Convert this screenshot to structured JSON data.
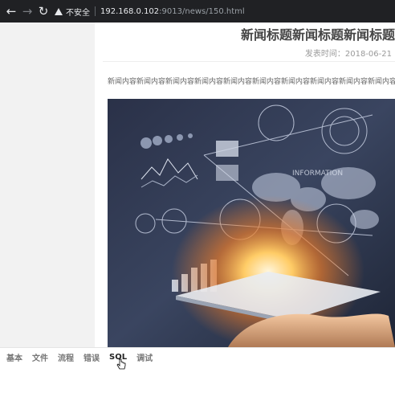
{
  "browser": {
    "security_label": "不安全",
    "url_host": "192.168.0.102",
    "url_path": ":9013/news/150.html"
  },
  "article": {
    "title": "新闻标题新闻标题新闻标题",
    "date": "发表时间：2018-06-21",
    "content": "新闻内容新闻内容新闻内容新闻内容新闻内容新闻内容新闻内容新闻内容新闻内容新闻内容"
  },
  "hero_image": {
    "overlay_text": "INFORMATION"
  },
  "devtools": {
    "tabs": [
      "基本",
      "文件",
      "流程",
      "错误",
      "SQL",
      "调试"
    ],
    "active_tab": "SQL"
  }
}
